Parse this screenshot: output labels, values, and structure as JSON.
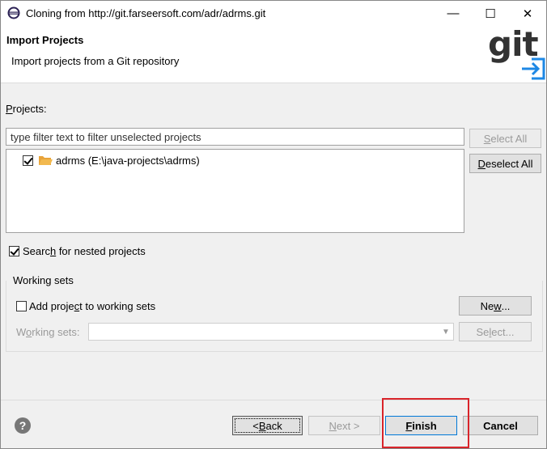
{
  "window": {
    "title": "Cloning from http://git.farseersoft.com/adr/adrms.git",
    "minimize_glyph": "—",
    "maximize_glyph": "☐",
    "close_glyph": "✕"
  },
  "header": {
    "title": "Import Projects",
    "subtitle": "Import projects from a Git repository",
    "logo_text": "git"
  },
  "projects": {
    "label_first": "P",
    "label_rest": "rojects:",
    "filter_placeholder": "type filter text to filter unselected projects",
    "select_all_u": "S",
    "select_all_rest": "elect All",
    "deselect_all_u": "D",
    "deselect_all_rest": "eselect All",
    "items": [
      {
        "label": "adrms (E:\\java-projects\\adrms)",
        "checked": true
      }
    ]
  },
  "nested": {
    "label_before": "Searc",
    "label_u": "h",
    "label_after": " for nested projects",
    "checked": true
  },
  "working_sets": {
    "group_title": "Working sets",
    "add_before": "Add proje",
    "add_u": "c",
    "add_after": "t to working sets",
    "add_checked": false,
    "new_before": "Ne",
    "new_u": "w",
    "new_after": "...",
    "sets_before": "W",
    "sets_u": "o",
    "sets_after": "rking sets:",
    "combo_value": "",
    "select_before": "Se",
    "select_u": "l",
    "select_after": "ect..."
  },
  "footer": {
    "help_glyph": "?",
    "back_before": "< ",
    "back_u": "B",
    "back_after": "ack",
    "next_before": "",
    "next_u": "N",
    "next_after": "ext >",
    "finish_u": "F",
    "finish_after": "inish",
    "cancel": "Cancel"
  },
  "colors": {
    "highlight": "#d9242a",
    "folder": "#e8a33a",
    "git_arrow": "#1e88e5"
  }
}
